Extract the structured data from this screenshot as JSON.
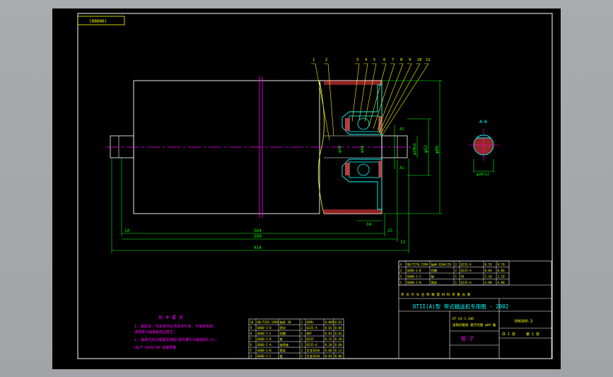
{
  "colors": {
    "background": "#a8aaac",
    "sheet": "#000000",
    "outline": "#ffffff",
    "dimension": "#00ff00",
    "centerline": "#ff00ff",
    "section": "#00ffff",
    "hatch": "#ff4040",
    "leader": "#ffff00"
  },
  "drawing": {
    "code_box": "(00000)",
    "section_label": "A–A",
    "leader_numbers": [
      "1",
      "2",
      "3",
      "4",
      "5",
      "6",
      "7",
      "8",
      "9",
      "10",
      "11"
    ],
    "dims": {
      "d364": "364",
      "d390": "390",
      "d414": "414",
      "d15": "15",
      "d12": "12",
      "d10": "10",
      "d34": "34",
      "dia_a": "φ89",
      "dia_b": "φ20",
      "dia_c": "φ44",
      "dia_d": "φ52",
      "dia_e": "φ20k6",
      "sec": "φ20×12",
      "a1": "A1",
      "a2": "A1"
    }
  },
  "notes": {
    "title": "技 术 要 求",
    "lines": [
      "1. 装配前, 所有零件必须清洗干净, 不得有毛刺;",
      "   滚筒体与轴承座焊后校正;",
      "2. 轴承内加注锂基润滑脂(填充量约为轴承腔1/2);",
      "   GB/T 9439-88 焊接质量"
    ]
  },
  "parts_left": [
    [
      "10",
      "GB/T292-1994",
      "轴承 30",
      "2",
      "65Mn",
      "0.005",
      "0.01"
    ],
    [
      "9",
      "G600-3-D",
      "密封",
      "2",
      "Q235-A",
      "0.02",
      "0.04"
    ],
    [
      "8",
      "G600-7-C",
      "挡圈",
      "2",
      "08F",
      "0.01",
      "0.02"
    ],
    [
      "7",
      "G600-2-D",
      "座",
      "2",
      "Q235",
      "0.15",
      "0.30"
    ],
    [
      "6",
      "G600-1-A",
      "轴承座",
      "2",
      "Q235-A",
      "0.30",
      "0.60"
    ],
    [
      "5",
      "G600-1-B",
      "筒体",
      "2",
      "尼龙1010",
      "0.06",
      "0.12"
    ],
    [
      "4",
      "G600-1-C",
      "盖",
      "2",
      "尼龙1010",
      "0.03",
      "0.06"
    ]
  ],
  "parts_right": [
    [
      "4",
      "GB/T276-1994",
      "轴承 6204/Z4",
      "2",
      "Q235-A",
      "0.35",
      "0.70"
    ],
    [
      "3",
      "G600-1-B",
      "挡圈",
      "2",
      "Q235-A",
      "0.04",
      "0.08"
    ],
    [
      "2",
      "G600-1-C",
      "轴",
      "1",
      "45",
      "2.10",
      "2.10"
    ],
    [
      "1",
      "G600-1-B",
      "筒体",
      "1",
      "Q235-A",
      "4.80",
      "4.80"
    ]
  ],
  "header_row": "序 号    代  号    名  称    数 量    材 料    单 重 总 重",
  "title_block": {
    "title": "DTII(A)型 带式输送机专用图 - 2002",
    "drawing_no": "00G00-3",
    "line1": "DT 63-3.108",
    "line2": "滚筒托辊组  辊子托辊 ø89 轴",
    "name": "辊  子",
    "scale_label": "共 1 张",
    "sheet_label": "第 1 张"
  }
}
